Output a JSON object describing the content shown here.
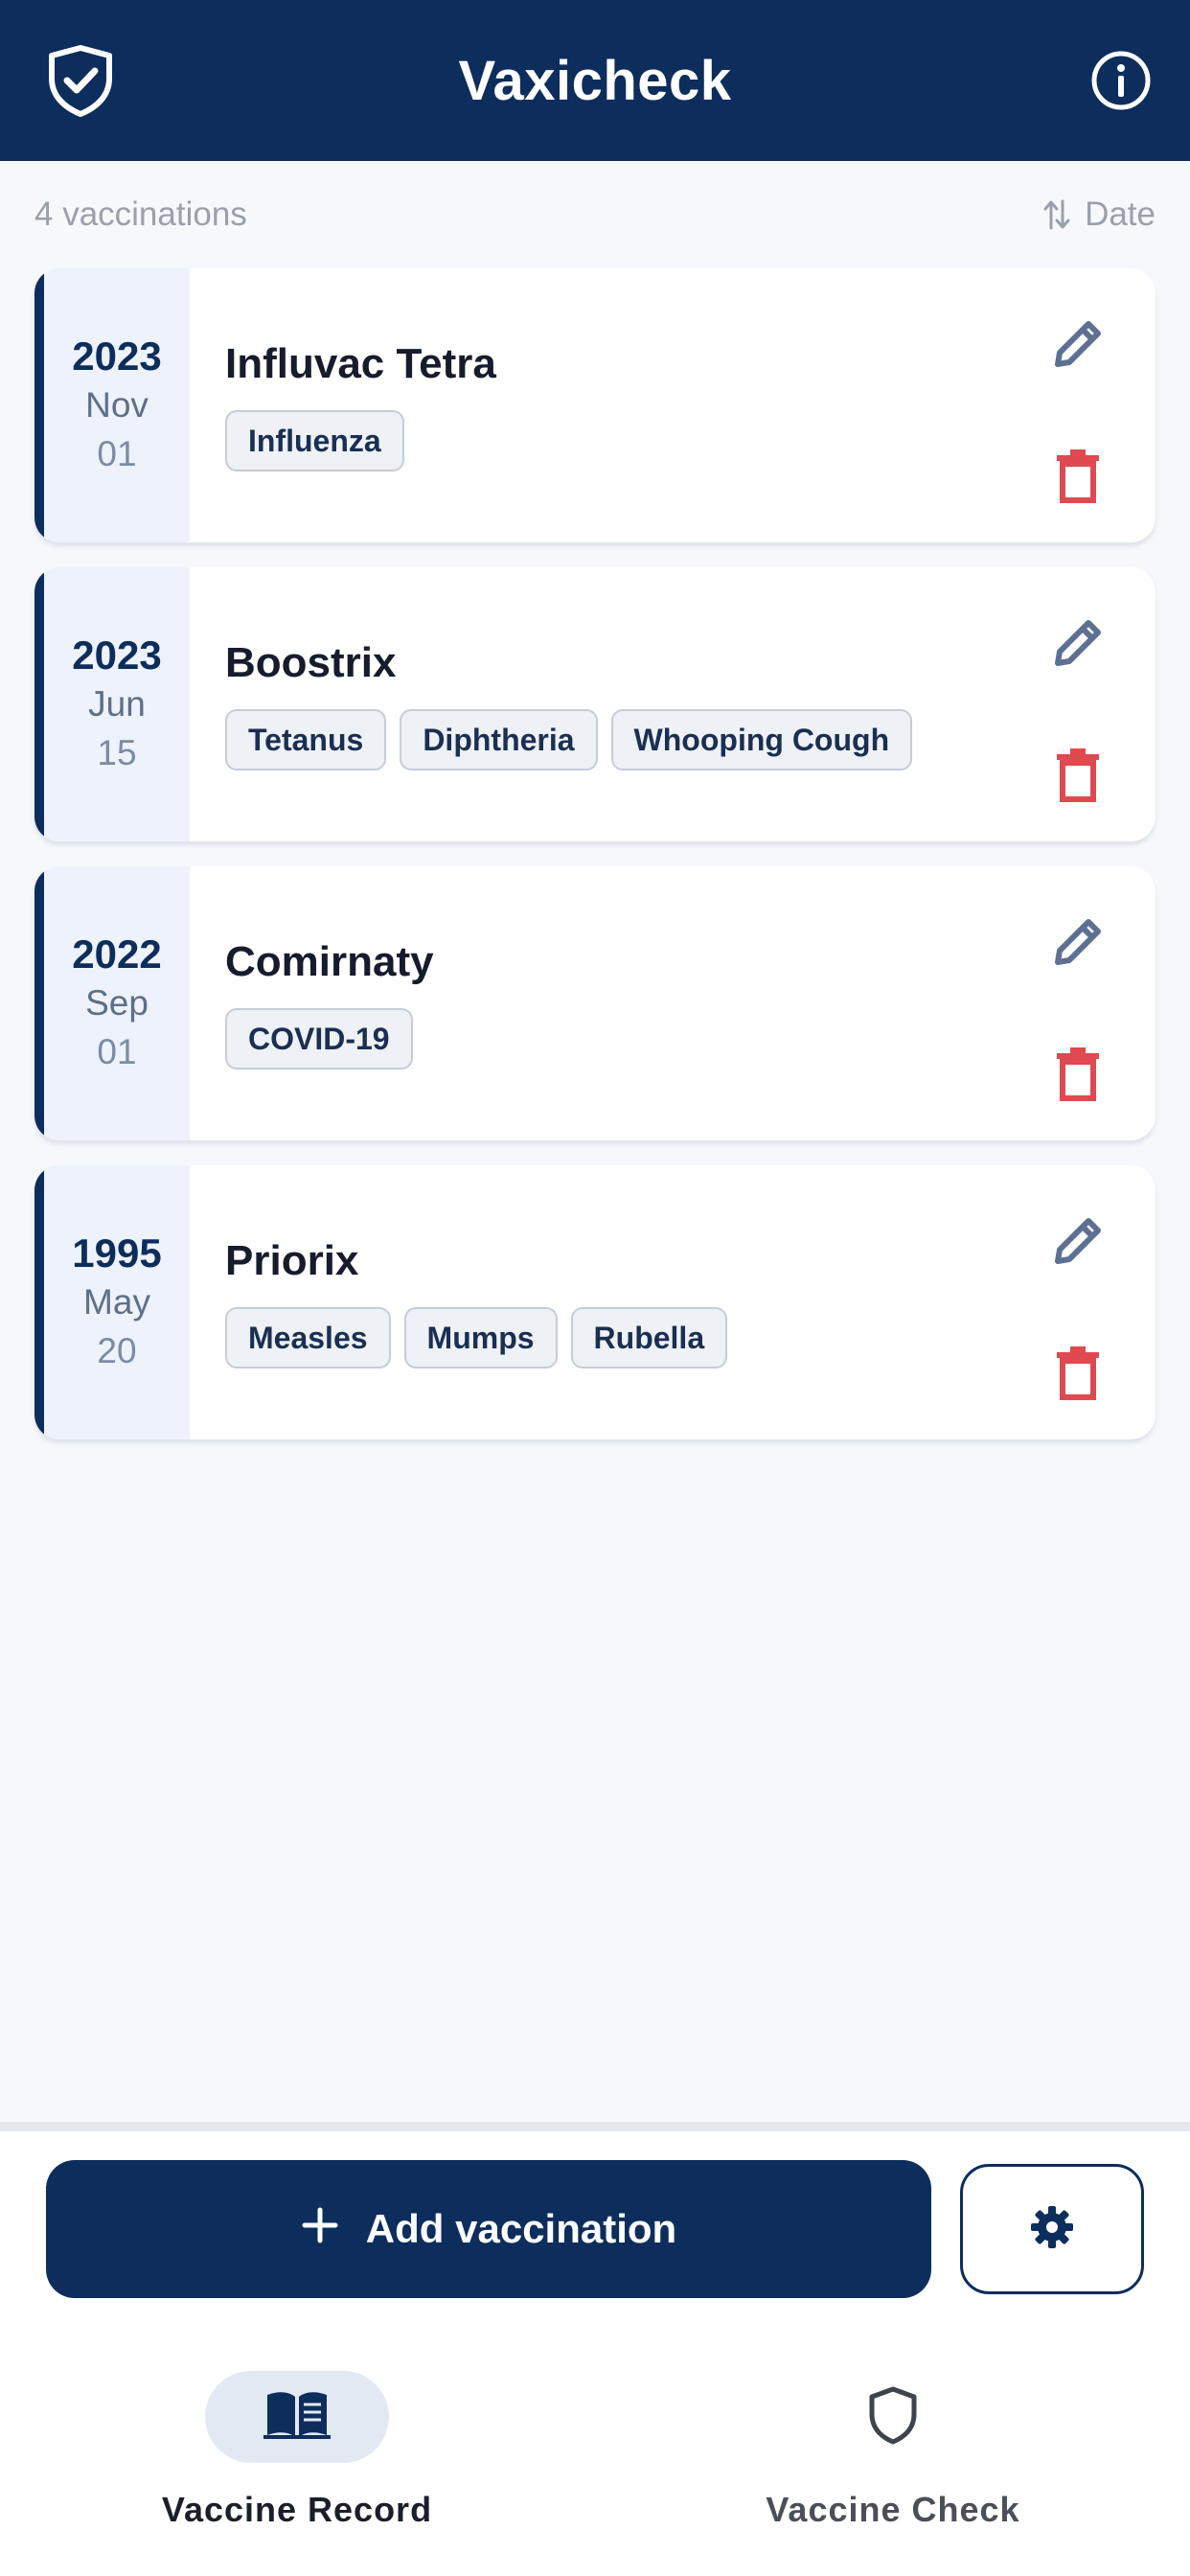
{
  "app": {
    "title": "Vaxicheck",
    "colors": {
      "primary": "#0d2d5c",
      "danger": "#e0494f",
      "edit": "#5d7092",
      "background": "#f6f8fc"
    },
    "icons": {
      "logo": "shield-check-icon",
      "info": "info-icon"
    }
  },
  "list": {
    "count_label": "4 vaccinations",
    "sort_label": "Date",
    "sort_icon": "sort-arrows-icon"
  },
  "vaccinations": [
    {
      "year": "2023",
      "month": "Nov",
      "day": "01",
      "name": "Influvac Tetra",
      "tags": [
        "Influenza"
      ]
    },
    {
      "year": "2023",
      "month": "Jun",
      "day": "15",
      "name": "Boostrix",
      "tags": [
        "Tetanus",
        "Diphtheria",
        "Whooping Cough"
      ]
    },
    {
      "year": "2022",
      "month": "Sep",
      "day": "01",
      "name": "Comirnaty",
      "tags": [
        "COVID-19"
      ]
    },
    {
      "year": "1995",
      "month": "May",
      "day": "20",
      "name": "Priorix",
      "tags": [
        "Measles",
        "Mumps",
        "Rubella"
      ]
    }
  ],
  "actions": {
    "add_label": "Add vaccination",
    "add_icon": "plus-icon",
    "settings_icon": "gear-icon"
  },
  "nav": {
    "items": [
      {
        "label": "Vaccine Record",
        "icon": "book-icon",
        "active": true
      },
      {
        "label": "Vaccine Check",
        "icon": "shield-icon",
        "active": false
      }
    ]
  }
}
